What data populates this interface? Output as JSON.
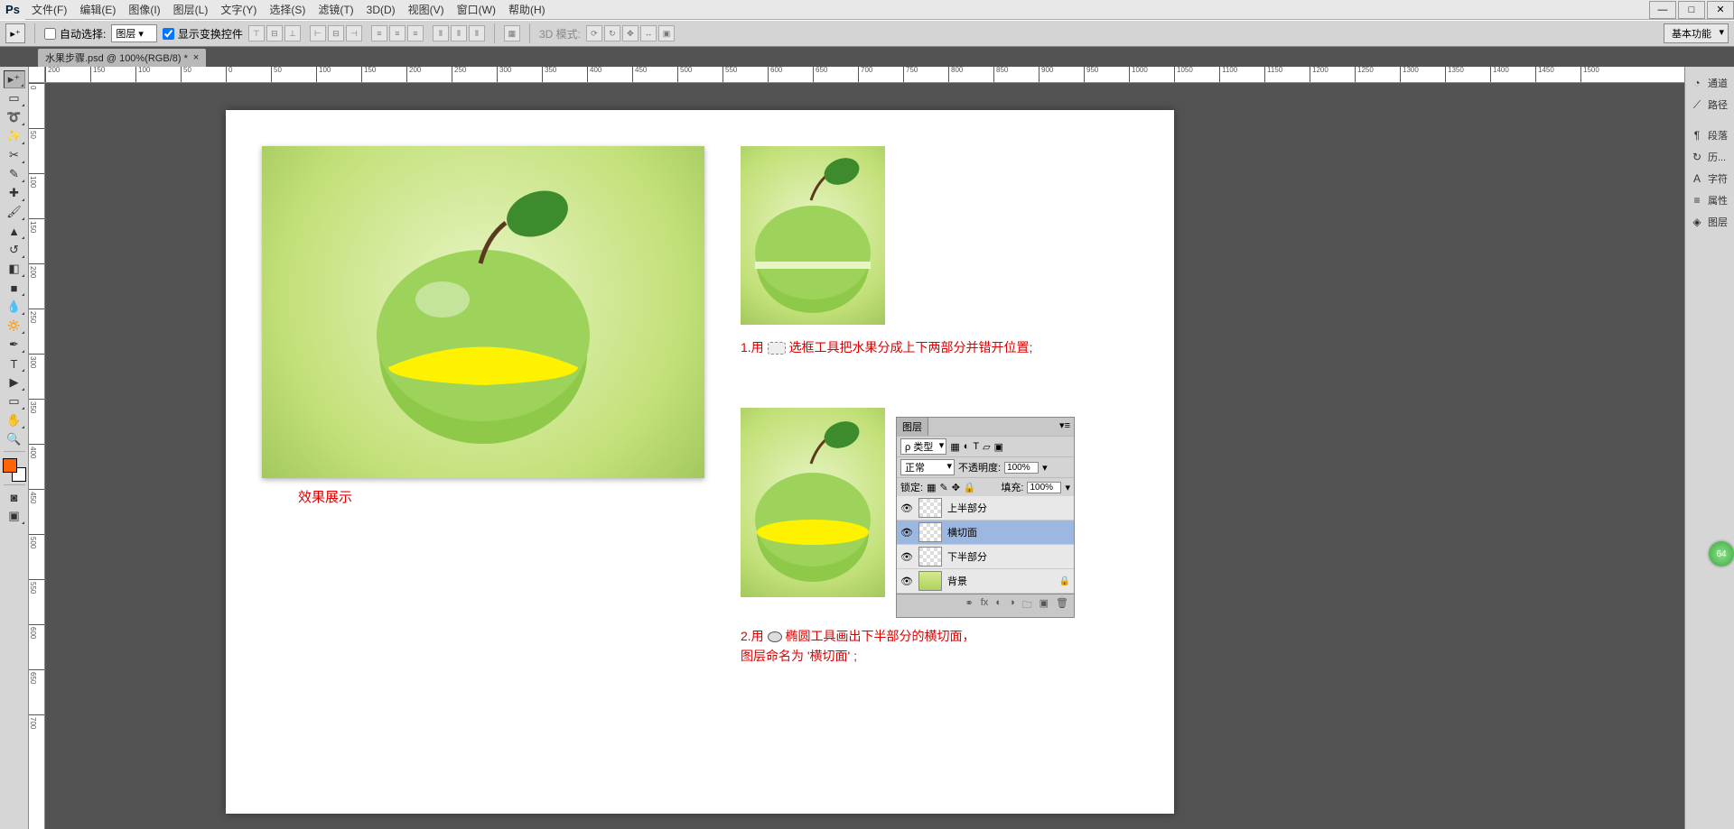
{
  "app": {
    "logo": "Ps"
  },
  "menu": [
    {
      "label": "文件(F)"
    },
    {
      "label": "编辑(E)"
    },
    {
      "label": "图像(I)"
    },
    {
      "label": "图层(L)"
    },
    {
      "label": "文字(Y)"
    },
    {
      "label": "选择(S)"
    },
    {
      "label": "滤镜(T)"
    },
    {
      "label": "3D(D)"
    },
    {
      "label": "视图(V)"
    },
    {
      "label": "窗口(W)"
    },
    {
      "label": "帮助(H)"
    }
  ],
  "window_controls": {
    "min": "—",
    "max": "□",
    "close": "✕"
  },
  "options": {
    "auto_select_label": "自动选择:",
    "auto_select_value": "图层",
    "show_transform_label": "显示变换控件",
    "threeD_label": "3D 模式:",
    "workspace": "基本功能"
  },
  "doctab": {
    "title": "水果步骤.psd @ 100%(RGB/8) *",
    "close": "×"
  },
  "ruler_marks_h": [
    "200",
    "150",
    "100",
    "50",
    "0",
    "50",
    "100",
    "150",
    "200",
    "250",
    "300",
    "350",
    "400",
    "450",
    "500",
    "550",
    "600",
    "650",
    "700",
    "750",
    "800",
    "850",
    "900",
    "950",
    "1000",
    "1050",
    "1100",
    "1150",
    "1200",
    "1250",
    "1300",
    "1350",
    "1400",
    "1450",
    "1500"
  ],
  "ruler_marks_v": [
    "0",
    "50",
    "100",
    "150",
    "200",
    "250",
    "300",
    "350",
    "400",
    "450",
    "500",
    "550",
    "600",
    "650",
    "700"
  ],
  "content": {
    "effect_label": "效果展示",
    "step1": "1.用",
    "step1b": "选框工具把水果分成上下两部分并错开位置;",
    "step2a": "2.用",
    "step2b": "椭圆工具画出下半部分的横切面，",
    "step2c": "图层命名为 '横切面' ;"
  },
  "layers_panel": {
    "tab": "图层",
    "kind": "ρ 类型",
    "blend": "正常",
    "opacity_label": "不透明度:",
    "opacity_val": "100%",
    "lock_label": "锁定:",
    "fill_label": "填充:",
    "fill_val": "100%",
    "layers": [
      {
        "name": "上半部分",
        "selected": false,
        "bg": false
      },
      {
        "name": "横切面",
        "selected": true,
        "bg": false
      },
      {
        "name": "下半部分",
        "selected": false,
        "bg": false
      },
      {
        "name": "背景",
        "selected": false,
        "bg": true,
        "locked": true
      }
    ],
    "footer_fx": "fx"
  },
  "dock": [
    {
      "icon": "◔",
      "label": "通道"
    },
    {
      "icon": "⟋",
      "label": "路径"
    },
    {
      "icon": "¶",
      "label": "段落"
    },
    {
      "icon": "↻",
      "label": "历..."
    },
    {
      "icon": "A",
      "label": "字符"
    },
    {
      "icon": "≡",
      "label": "属性"
    },
    {
      "icon": "◈",
      "label": "图层"
    }
  ],
  "badge": "64"
}
